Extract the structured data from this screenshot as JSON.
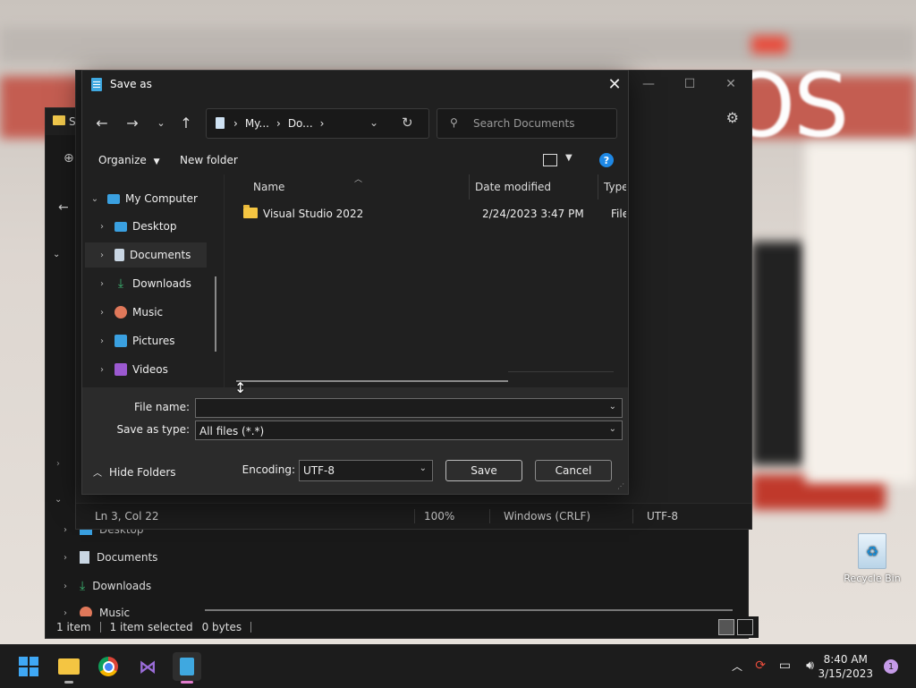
{
  "desktop": {
    "bg_text": "OS",
    "recycle_bin_label": "Recycle Bin"
  },
  "explorer": {
    "title_fragment": "S",
    "sidebar": [
      {
        "label": "Desktop"
      },
      {
        "label": "Documents"
      },
      {
        "label": "Downloads"
      },
      {
        "label": "Music"
      }
    ],
    "status": {
      "count": "1 item",
      "selected": "1 item selected",
      "size": "0 bytes"
    }
  },
  "notepad": {
    "status": {
      "position": "Ln 3, Col 22",
      "zoom": "100%",
      "line_ending": "Windows (CRLF)",
      "encoding": "UTF-8"
    }
  },
  "dialog": {
    "title": "Save as",
    "address": {
      "crumbs": [
        "My...",
        "Do..."
      ]
    },
    "search_placeholder": "Search Documents",
    "commands": {
      "organize": "Organize",
      "new_folder": "New folder"
    },
    "tree": [
      {
        "label": "My Computer",
        "expanded": true,
        "color": "#3aa0e0"
      },
      {
        "label": "Desktop",
        "color": "#3aa0e0"
      },
      {
        "label": "Documents",
        "selected": true,
        "color": "#c9d6e3"
      },
      {
        "label": "Downloads",
        "color": "#3cb371"
      },
      {
        "label": "Music",
        "color": "#e0785a"
      },
      {
        "label": "Pictures",
        "color": "#3aa0e0"
      },
      {
        "label": "Videos",
        "color": "#9b59d0"
      }
    ],
    "columns": {
      "name": "Name",
      "date_modified": "Date modified",
      "type": "Type"
    },
    "files": [
      {
        "name": "Visual Studio 2022",
        "date": "2/24/2023 3:47 PM",
        "type": "File fo"
      }
    ],
    "form": {
      "file_name_label": "File name:",
      "file_name_value": "",
      "save_type_label": "Save as type:",
      "save_type_value": "All files  (*.*)",
      "encoding_label": "Encoding:",
      "encoding_value": "UTF-8",
      "save": "Save",
      "cancel": "Cancel",
      "hide_folders": "Hide Folders"
    }
  },
  "taskbar": {
    "time": "8:40 AM",
    "date": "3/15/2023",
    "notifications": "1"
  }
}
